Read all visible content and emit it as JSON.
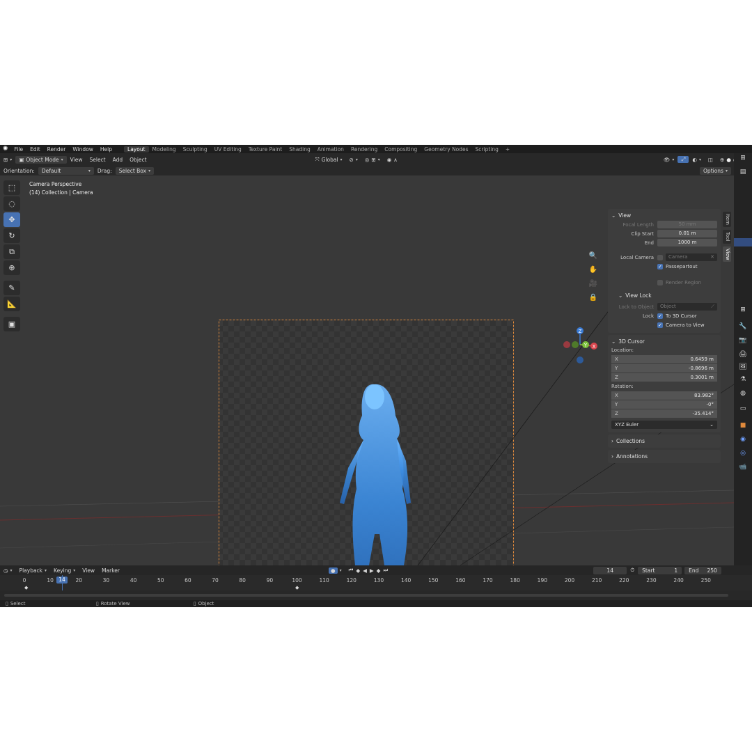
{
  "menu": {
    "items": [
      "File",
      "Edit",
      "Render",
      "Window",
      "Help"
    ],
    "workspaces": [
      "Layout",
      "Modeling",
      "Sculpting",
      "UV Editing",
      "Texture Paint",
      "Shading",
      "Animation",
      "Rendering",
      "Compositing",
      "Geometry Nodes",
      "Scripting"
    ],
    "add_tab": "+"
  },
  "header": {
    "mode": "Object Mode",
    "menus": [
      "View",
      "Select",
      "Add",
      "Object"
    ],
    "transform_orientation": "Global",
    "options": "Options"
  },
  "header2": {
    "orientation_label": "Orientation:",
    "orientation_value": "Default",
    "drag_label": "Drag:",
    "drag_value": "Select Box"
  },
  "viewport": {
    "camera_label": "Camera Perspective",
    "collection_label": "(14) Collection | Camera",
    "gizmo_axes": [
      "Z",
      "Y",
      "X"
    ]
  },
  "npanel": {
    "tabs": [
      "Item",
      "Tool",
      "View"
    ],
    "view": {
      "title": "View",
      "focal_length_label": "Focal Length",
      "focal_length": "50 mm",
      "clip_start_label": "Clip Start",
      "clip_start": "0.01 m",
      "end_label": "End",
      "end": "1000 m",
      "local_camera_label": "Local Camera",
      "local_camera_value": "Camera",
      "passepartout": "Passepartout",
      "render_region": "Render Region"
    },
    "view_lock": {
      "title": "View Lock",
      "lock_to_object_label": "Lock to Object",
      "lock_to_object_placeholder": "Object",
      "lock_label": "Lock",
      "to_3d_cursor": "To 3D Cursor",
      "camera_to_view": "Camera to View"
    },
    "cursor": {
      "title": "3D Cursor",
      "location_label": "Location:",
      "loc_x": "0.6459 m",
      "loc_y": "-0.8696 m",
      "loc_z": "0.3001 m",
      "rotation_label": "Rotation:",
      "rot_x": "83.982°",
      "rot_y": "-0°",
      "rot_z": "-35.414°",
      "rotation_mode": "XYZ Euler"
    },
    "collections": "Collections",
    "annotations": "Annotations"
  },
  "timeline": {
    "menus": [
      "Playback",
      "Keying",
      "View",
      "Marker"
    ],
    "current_frame": "14",
    "start_label": "Start",
    "start": "1",
    "end_label": "End",
    "end": "250",
    "ticks": [
      "0",
      "10",
      "20",
      "30",
      "40",
      "50",
      "60",
      "70",
      "80",
      "90",
      "100",
      "110",
      "120",
      "130",
      "140",
      "150",
      "160",
      "170",
      "180",
      "190",
      "200",
      "210",
      "220",
      "230",
      "240",
      "250"
    ],
    "playhead": "14"
  },
  "status": {
    "select": "Select",
    "rotate_view": "Rotate View",
    "object": "Object"
  }
}
